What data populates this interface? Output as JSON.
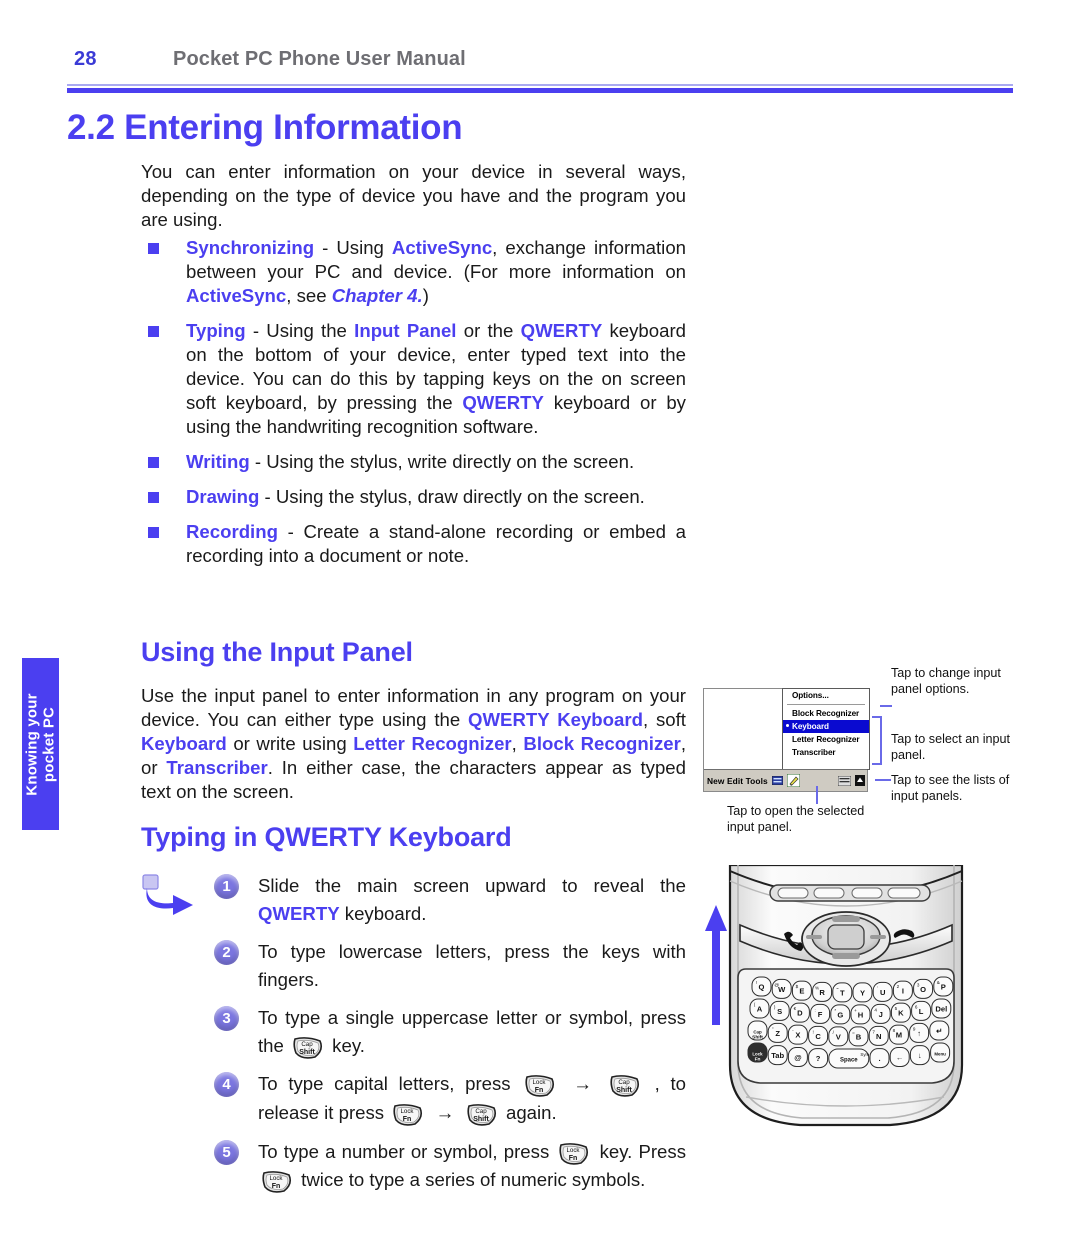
{
  "header": {
    "page_number": "28",
    "title": "Pocket PC Phone User Manual"
  },
  "section": {
    "title": "2.2 Entering Information",
    "intro": "You can enter information on your device in several ways, depending on the type of device you have and the program you are using."
  },
  "bullets": [
    {
      "name": "synchronizing",
      "segments": [
        {
          "text": "Synchronizing",
          "style": "hl"
        },
        {
          "text": " - Using ",
          "style": "plain"
        },
        {
          "text": "ActiveSync",
          "style": "hl"
        },
        {
          "text": ", exchange information between your PC and device. (For more information on ",
          "style": "plain"
        },
        {
          "text": "ActiveSync",
          "style": "hl"
        },
        {
          "text": ", see ",
          "style": "plain"
        },
        {
          "text": "Chapter 4.",
          "style": "hl-italic"
        },
        {
          "text": ")",
          "style": "plain"
        }
      ]
    },
    {
      "name": "typing",
      "segments": [
        {
          "text": "Typing",
          "style": "hl"
        },
        {
          "text": " -  Using the ",
          "style": "plain"
        },
        {
          "text": "Input Panel",
          "style": "hl"
        },
        {
          "text": " or the ",
          "style": "plain"
        },
        {
          "text": "QWERTY",
          "style": "hl"
        },
        {
          "text": " keyboard on the bottom of your device, enter typed text into the device. You can do this by tapping keys on the on screen soft keyboard, by pressing the ",
          "style": "plain"
        },
        {
          "text": "QWERTY",
          "style": "hl"
        },
        {
          "text": " keyboard or by using the handwriting recognition software.",
          "style": "plain"
        }
      ]
    },
    {
      "name": "writing",
      "segments": [
        {
          "text": "Writing",
          "style": "hl"
        },
        {
          "text": " - Using the stylus, write directly on the screen.",
          "style": "plain"
        }
      ]
    },
    {
      "name": "drawing",
      "segments": [
        {
          "text": "Drawing",
          "style": "hl"
        },
        {
          "text": " - Using the stylus, draw directly on the screen.",
          "style": "plain"
        }
      ]
    },
    {
      "name": "recording",
      "segments": [
        {
          "text": "Recording",
          "style": "hl"
        },
        {
          "text": " - Create a stand-alone recording or embed a recording into a document or note.",
          "style": "plain"
        }
      ]
    }
  ],
  "input_panel": {
    "heading": "Using the Input Panel",
    "body_segments": [
      {
        "text": "Use the input panel to enter information in any program on your device. You can either type using the ",
        "style": "plain"
      },
      {
        "text": "QWERTY Keyboard",
        "style": "hl"
      },
      {
        "text": ", soft ",
        "style": "plain"
      },
      {
        "text": "Keyboard",
        "style": "hl"
      },
      {
        "text": " or write using ",
        "style": "plain"
      },
      {
        "text": "Letter Recognizer",
        "style": "hl"
      },
      {
        "text": ", ",
        "style": "plain"
      },
      {
        "text": "Block Recognizer",
        "style": "hl"
      },
      {
        "text": ", or ",
        "style": "plain"
      },
      {
        "text": "Transcriber",
        "style": "hl"
      },
      {
        "text": ". In either case, the characters appear as typed text on the screen.",
        "style": "plain"
      }
    ]
  },
  "qwerty": {
    "heading": "Typing in QWERTY Keyboard",
    "steps": [
      {
        "number": "1",
        "segments": [
          {
            "text": "Slide the main screen upward to reveal the ",
            "style": "plain"
          },
          {
            "text": "QWERTY",
            "style": "hl"
          },
          {
            "text": " keyboard.",
            "style": "plain"
          }
        ]
      },
      {
        "number": "2",
        "segments": [
          {
            "text": "To type lowercase letters, press the keys with fingers.",
            "style": "plain"
          }
        ]
      },
      {
        "number": "3",
        "segments": [
          {
            "text": "To type a single uppercase letter or symbol, press the ",
            "style": "plain"
          },
          {
            "key": "Cap Shift"
          },
          {
            "text": " key.",
            "style": "plain"
          }
        ]
      },
      {
        "number": "4",
        "segments": [
          {
            "text": "To type capital letters, press ",
            "style": "plain"
          },
          {
            "key": "Lock Fn"
          },
          {
            "text": " → ",
            "style": "arrow"
          },
          {
            "key": "Cap Shift"
          },
          {
            "text": " , to release it press ",
            "style": "plain"
          },
          {
            "key": "Lock Fn"
          },
          {
            "text": " → ",
            "style": "arrow"
          },
          {
            "key": "Cap Shift"
          },
          {
            "text": " again.",
            "style": "plain"
          }
        ]
      },
      {
        "number": "5",
        "segments": [
          {
            "text": "To type a number or symbol, press ",
            "style": "plain"
          },
          {
            "key": "Lock Fn"
          },
          {
            "text": " key. Press ",
            "style": "plain"
          },
          {
            "key": "Lock Fn"
          },
          {
            "text": " twice to type a series of numeric symbols.",
            "style": "plain"
          }
        ]
      }
    ]
  },
  "side_tab": {
    "line1": "Knowing your",
    "line2": "pocket PC"
  },
  "figure": {
    "context_menu": {
      "options_item": "Options...",
      "items": [
        {
          "label": "Block Recognizer",
          "selected": false
        },
        {
          "label": "Keyboard",
          "selected": true
        },
        {
          "label": "Letter Recognizer",
          "selected": false
        },
        {
          "label": "Transcriber",
          "selected": false
        }
      ]
    },
    "toolbar": {
      "menus": "New  Edit  Tools"
    },
    "callouts": {
      "change_options": "Tap to change input panel options.",
      "select_panel": "Tap to select an input panel.",
      "see_lists": "Tap to see the lists of input panels.",
      "open_panel": "Tap to open the selected input panel."
    }
  },
  "device_keyboard": {
    "row1": [
      "Q",
      "W",
      "E",
      "R",
      "T",
      "Y",
      "U",
      "I",
      "O",
      "P"
    ],
    "row1_sup": [
      "!",
      "@",
      "$",
      "%",
      "~",
      "",
      "'",
      "2",
      "3",
      "&"
    ],
    "row2": [
      "A",
      "S",
      "D",
      "F",
      "G",
      "H",
      "J",
      "K",
      "L",
      "Del"
    ],
    "row2_sup": [
      "(",
      ")",
      "€",
      ":",
      "*",
      "+",
      "4",
      "5",
      "6",
      ""
    ],
    "row3": [
      "Cap Shift",
      "Z",
      "X",
      "C",
      "V",
      "B",
      "N",
      "M",
      "↑",
      "↵"
    ],
    "row3_sup": [
      "",
      "\"",
      "-",
      "!",
      "/",
      "=",
      "7",
      "8",
      "9",
      ""
    ],
    "row4": [
      "Lock Fn",
      "Tab",
      "@",
      "?",
      "Space",
      ".",
      "←",
      "↓",
      "Menu"
    ],
    "space_label": "Space",
    "space_sup": "Sym"
  },
  "colors": {
    "accent": "#4b3ff0",
    "header_gray": "#6e6e73",
    "step_circle": "#7b76e0",
    "selection": "#0a0ad0"
  }
}
